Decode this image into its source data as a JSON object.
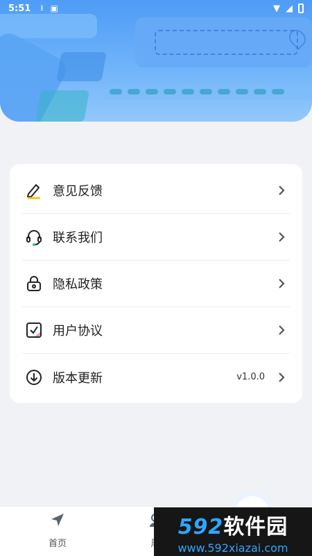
{
  "status_bar": {
    "time": "5:51"
  },
  "menu": {
    "items": [
      {
        "label": "意见反馈",
        "icon": "edit-icon",
        "value": ""
      },
      {
        "label": "联系我们",
        "icon": "headset-icon",
        "value": ""
      },
      {
        "label": "隐私政策",
        "icon": "lock-icon",
        "value": ""
      },
      {
        "label": "用户协议",
        "icon": "checkbox-icon",
        "value": ""
      },
      {
        "label": "版本更新",
        "icon": "download-icon",
        "value": "v1.0.0"
      }
    ]
  },
  "bottom_nav": {
    "items": [
      {
        "label": "首页",
        "icon": "navigation-arrow-icon"
      },
      {
        "label": "周",
        "icon": "location-person-icon"
      }
    ]
  },
  "watermark": {
    "number": "592",
    "text": "软件园",
    "url": "www.592xiazai.com"
  },
  "colors": {
    "header_blue": "#4e9cf6",
    "accent_yellow": "#f5c518",
    "accent_green": "#35c27a",
    "accent_pink": "#f39ab6",
    "watermark_blue": "#2ea6ff"
  }
}
